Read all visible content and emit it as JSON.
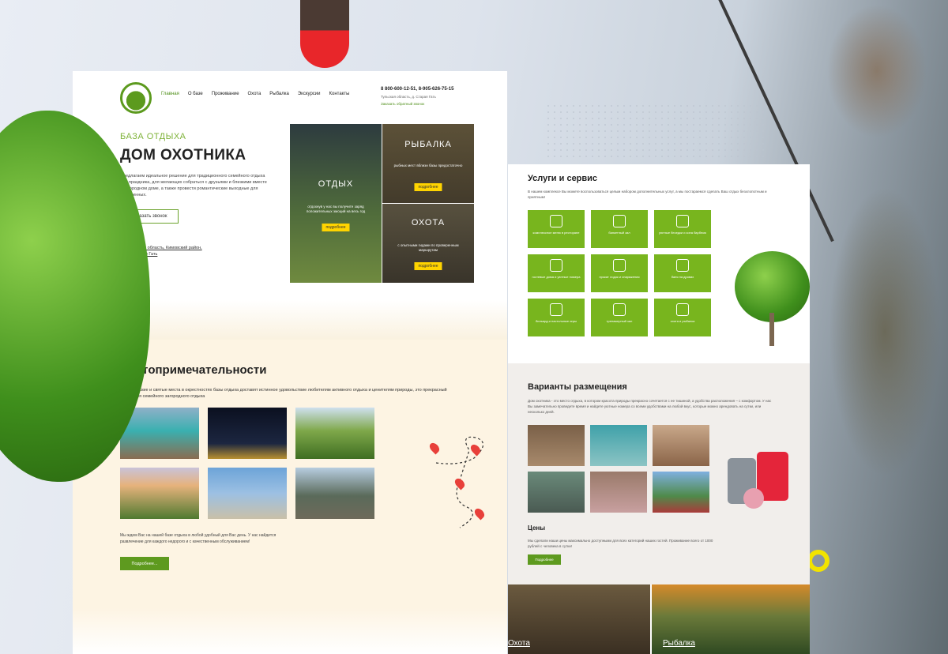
{
  "site": {
    "menu": [
      "Главная",
      "О базе",
      "Проживание",
      "Охота",
      "Рыбалка",
      "Экскурсии",
      "Контакты"
    ],
    "phones": "8 800-600-12-51, 8-905-626-75-15",
    "address_top": "Тульская область, д. Старая Гать",
    "callback_link": "Заказать обратный звонок"
  },
  "hero": {
    "subtitle": "БАЗА ОТДЫХА",
    "title": "ДОМ ОХОТНИКА",
    "intro": "Предлагаем идеальное решение для традиционного семейного отдыха или праздника, для желающих собраться с друзьями и близкими вместе в загородном доме, а также провести романтические выходные для влюбленных.",
    "cta": "Заказать звонок",
    "address_line1": "Тульская область, Кимовский район,",
    "address_line2": "д. Старая Гать"
  },
  "tiles": {
    "rest": {
      "title": "ОТДЫХ",
      "text": "отдохнув у нас вы получите заряд положительных эмоций на весь год",
      "btn": "подробнее"
    },
    "fishing": {
      "title": "РЫБАЛКА",
      "text": "рыбных мест вблизи базы предостаточно",
      "btn": "подробнее"
    },
    "hunting": {
      "title": "ОХОТА",
      "text": "с опытными гидами по проверенным маршрутам",
      "btn": "подробнее"
    }
  },
  "attractions": {
    "title": "Достопримечательности",
    "text": "Исторические и святые места в окрестностях базы отдыха доставят истинное удовольствие любителям активного отдыха и ценителям природы, это прекрасный выбор для семейного загородного отдыха",
    "bottom_text": "Мы ждем Вас на нашей базе отдыха в любой удобный для Вас день. У нас найдется развлечение для каждого недорого и с качественным обслуживанием!",
    "more": "Подробнее..."
  },
  "services": {
    "title": "Услуги и сервис",
    "text": "В нашем комплексе Вы можете воспользоваться целым набором дополнительных услуг, а мы постараемся сделать Ваш отдых безхлопотным и приятным!",
    "items": [
      "комплексное меню в ресторане",
      "банкетный зал",
      "уютные беседки и зона барбекю",
      "гостевые дома и уютные номера",
      "прокат лодок и снаряжения",
      "баня на дровах",
      "бильярд и настольные игры",
      "тренажерный зал",
      "охота и рыбалка"
    ]
  },
  "accommodation": {
    "title": "Варианты размещения",
    "text": "Дом охотника - это место отдыха, в котором красота природы прекрасно сочетается с ее тишиной, а удобства расположения – с комфортом. У нас Вы замечательно проведете время и найдете уютные номера со всеми удобствами на любой вкус, которые можно арендовать на сутки, или несколько дней.",
    "prices_title": "Цены",
    "prices_text": "Мы сделали наши цены максимально доступными для всех категорий наших гостей. Проживание всего от 1000 рублей с человека в сутки!",
    "more": "Подробнее"
  },
  "strips": {
    "hunting": "Охота",
    "fishing": "Рыбалка"
  },
  "colors": {
    "accent": "#78b51e",
    "button": "#5e9a1f",
    "yellow": "#ffd400",
    "pin": "#e8403a",
    "cream": "#fdf4e3"
  }
}
